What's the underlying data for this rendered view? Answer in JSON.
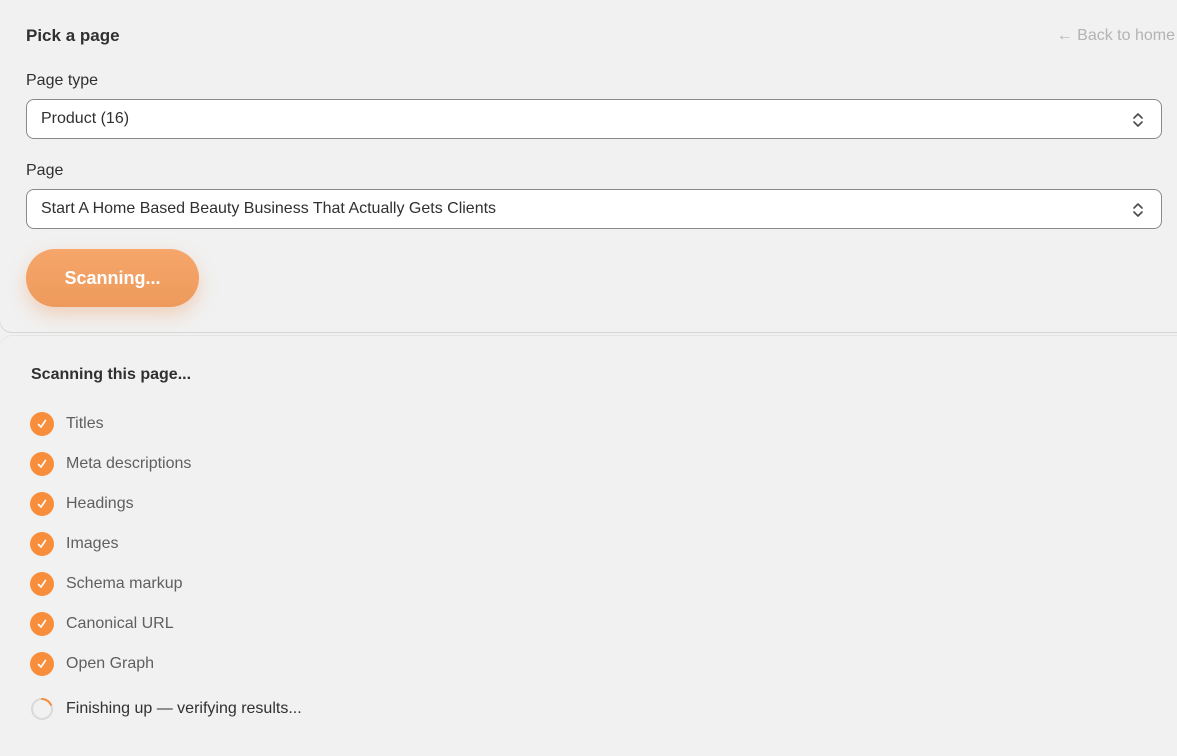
{
  "picker": {
    "title": "Pick a page",
    "back_link": "← Back to home",
    "page_type_label": "Page type",
    "page_type_value": "Product (16)",
    "page_label": "Page",
    "page_value": "Start A Home Based Beauty Business That Actually Gets Clients",
    "scan_button": "Scanning..."
  },
  "scan": {
    "heading": "Scanning this page...",
    "checks": [
      {
        "label": "Titles",
        "status": "done"
      },
      {
        "label": "Meta descriptions",
        "status": "done"
      },
      {
        "label": "Headings",
        "status": "done"
      },
      {
        "label": "Images",
        "status": "done"
      },
      {
        "label": "Schema markup",
        "status": "done"
      },
      {
        "label": "Canonical URL",
        "status": "done"
      },
      {
        "label": "Open Graph",
        "status": "done"
      }
    ],
    "finishing": "Finishing up — verifying results..."
  },
  "colors": {
    "accent": "#f88e3c",
    "button": "#f2a064",
    "text": "#303030",
    "muted": "#b3b3b3"
  }
}
